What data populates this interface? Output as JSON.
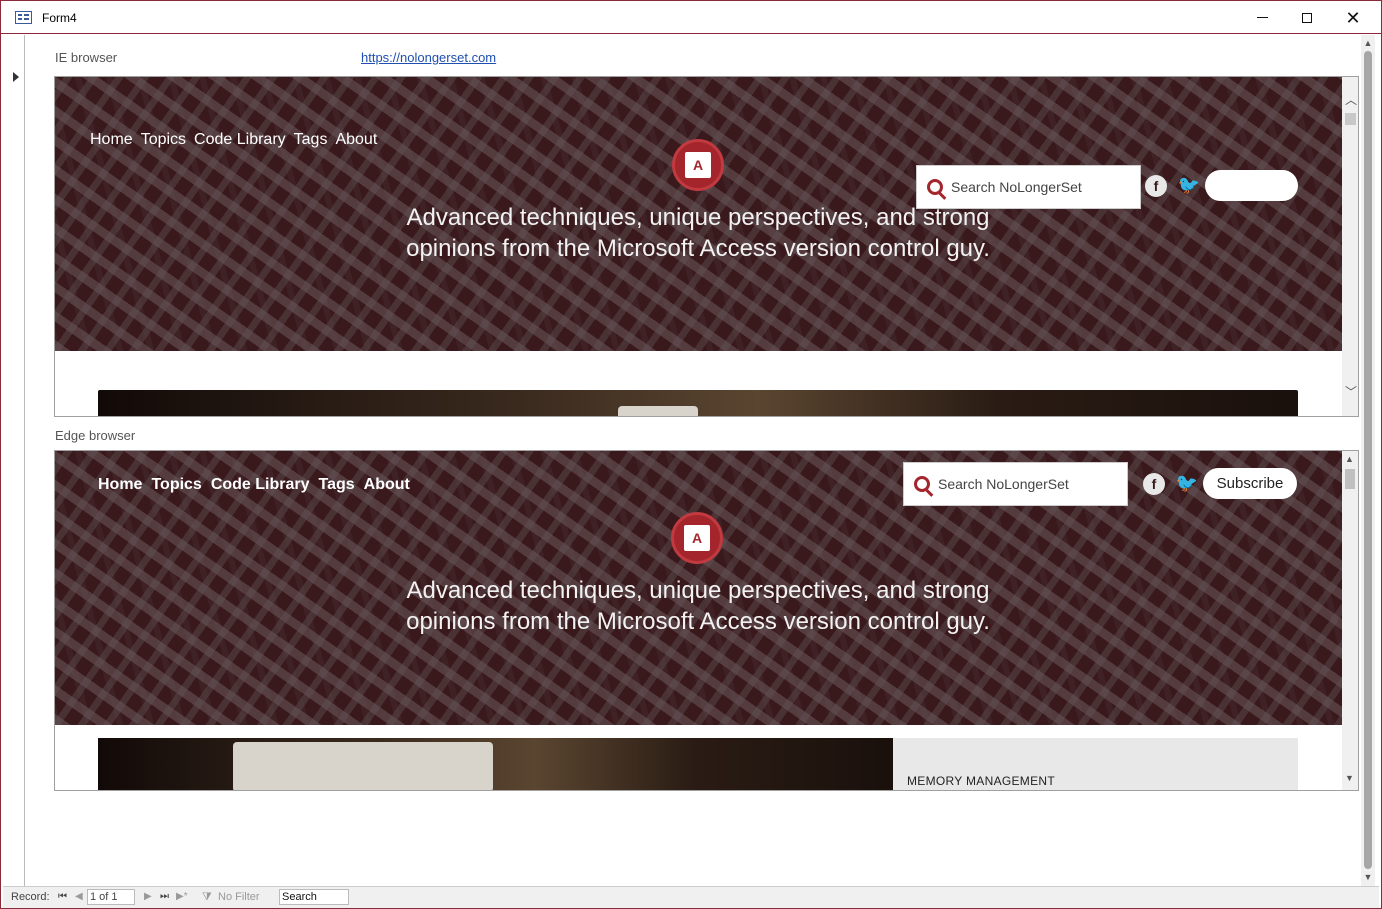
{
  "window": {
    "title": "Form4"
  },
  "form": {
    "ie_label": "IE browser",
    "edge_label": "Edge browser",
    "url": "https://nolongerset.com"
  },
  "site": {
    "nav": [
      "Home",
      "Topics",
      "Code Library",
      "Tags",
      "About"
    ],
    "tagline": "Advanced techniques, unique perspectives, and strong opinions from the Microsoft Access version control guy.",
    "search_placeholder": "Search NoLongerSet",
    "subscribe_label": "Subscribe",
    "ie_subscribe_label": "",
    "logo_letter": "A",
    "card_category": "MEMORY MANAGEMENT",
    "colors": {
      "accent": "#a4262c",
      "hero_bg": "#3a1a1d"
    }
  },
  "statusbar": {
    "record_label": "Record:",
    "record_value": "1 of 1",
    "filter_label": "No Filter",
    "search_value": "Search"
  }
}
